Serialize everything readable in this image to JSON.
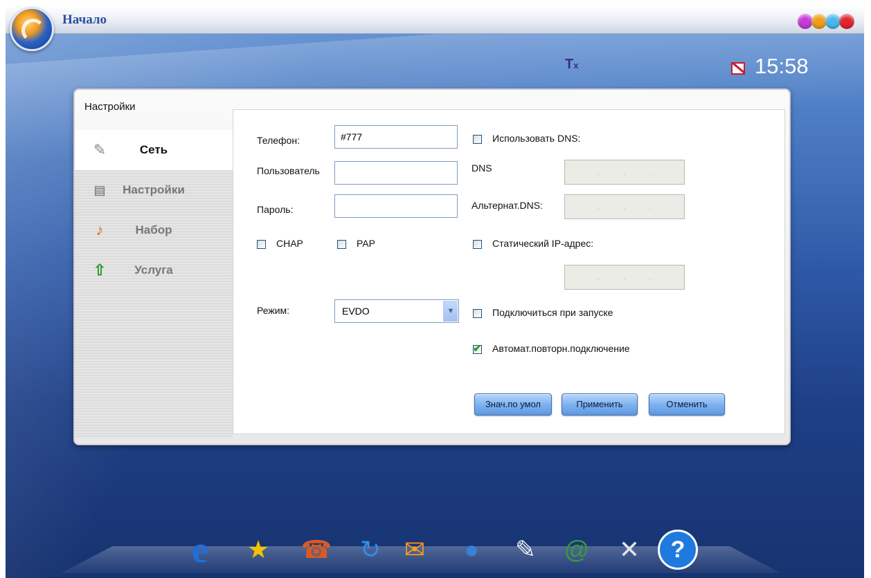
{
  "window": {
    "title": "Начало"
  },
  "status": {
    "signal_icon": "Ỵ",
    "signal_sub": "x",
    "time": "15:58"
  },
  "panel": {
    "title": "Настройки",
    "sidebar": [
      {
        "label": "Сеть",
        "icon": "paperclip-icon",
        "active": true
      },
      {
        "label": "Настройки",
        "icon": "list-icon",
        "active": false
      },
      {
        "label": "Набор",
        "icon": "note-icon",
        "active": false
      },
      {
        "label": "Услуга",
        "icon": "up-arrow-icon",
        "active": false
      }
    ],
    "form": {
      "phone_label": "Телефон:",
      "phone_value": "#777",
      "user_label": "Пользователь",
      "user_value": "",
      "password_label": "Пароль:",
      "password_value": "",
      "chap_label": "CHAP",
      "pap_label": "PAP",
      "mode_label": "Режим:",
      "mode_value": "EVDO",
      "use_dns_label": "Использовать DNS:",
      "dns_label": "DNS",
      "alt_dns_label": "Альтернат.DNS:",
      "static_ip_label": "Статический IP-адрес:",
      "connect_on_start_label": "Подключиться при запуске",
      "auto_reconnect_label": "Автомат.повторн.подключение",
      "ip_placeholder": ".   .   ."
    },
    "buttons": {
      "defaults": "Знач.по умол",
      "apply": "Применить",
      "cancel": "Отменить"
    }
  },
  "dock": [
    "ie-icon",
    "favorites-icon",
    "phone-icon",
    "sync-icon",
    "mailbox-icon",
    "globe-icon",
    "notepad-icon",
    "email-book-icon",
    "tools-icon",
    "help-icon"
  ]
}
